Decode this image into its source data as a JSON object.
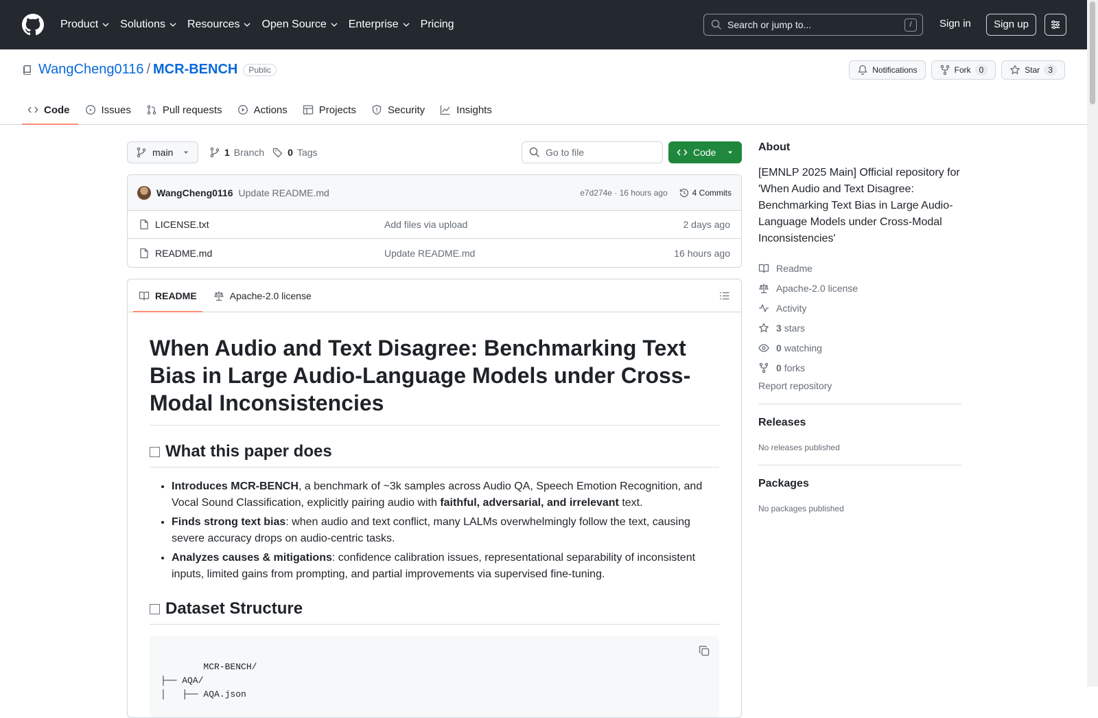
{
  "header": {
    "nav": [
      "Product",
      "Solutions",
      "Resources",
      "Open Source",
      "Enterprise",
      "Pricing"
    ],
    "search_placeholder": "Search or jump to...",
    "search_shortcut": "/",
    "sign_in": "Sign in",
    "sign_up": "Sign up"
  },
  "repo": {
    "owner": "WangCheng0116",
    "separator": "/",
    "name": "MCR-BENCH",
    "visibility": "Public",
    "notifications_label": "Notifications",
    "fork_label": "Fork",
    "fork_count": "0",
    "star_label": "Star",
    "star_count": "3"
  },
  "tabs": [
    "Code",
    "Issues",
    "Pull requests",
    "Actions",
    "Projects",
    "Security",
    "Insights"
  ],
  "toolbar": {
    "branch": "main",
    "branch_count": "1",
    "branch_label": "Branch",
    "tag_count": "0",
    "tag_label": "Tags",
    "go_to_file": "Go to file",
    "code_button": "Code"
  },
  "commit": {
    "author": "WangCheng0116",
    "message": "Update README.md",
    "hash_time": "e7d274e · 16 hours ago",
    "commits": "4 Commits"
  },
  "files": [
    {
      "name": "LICENSE.txt",
      "message": "Add files via upload",
      "date": "2 days ago"
    },
    {
      "name": "README.md",
      "message": "Update README.md",
      "date": "16 hours ago"
    }
  ],
  "readme": {
    "tab_readme": "README",
    "tab_license": "Apache-2.0 license",
    "title": "When Audio and Text Disagree: Benchmarking Text Bias in Large Audio-Language Models under Cross-Modal Inconsistencies",
    "section1": "What this paper does",
    "bullets": [
      {
        "bold": "Introduces MCR-BENCH",
        "text1": ", a benchmark of ~3k samples across Audio QA, Speech Emotion Recognition, and Vocal Sound Classification, explicitly pairing audio with ",
        "bold2": "faithful, adversarial, and irrelevant",
        "text2": " text."
      },
      {
        "bold": "Finds strong text bias",
        "text1": ": when audio and text conflict, many LALMs overwhelmingly follow the text, causing severe accuracy drops on audio-centric tasks.",
        "bold2": "",
        "text2": ""
      },
      {
        "bold": "Analyzes causes & mitigations",
        "text1": ": confidence calibration issues, representational separability of inconsistent inputs, limited gains from prompting, and partial improvements via supervised fine-tuning.",
        "bold2": "",
        "text2": ""
      }
    ],
    "section2": "Dataset Structure",
    "code": "MCR-BENCH/\n├── AQA/\n│   ├── AQA.json"
  },
  "about": {
    "heading": "About",
    "description": "[EMNLP 2025 Main] Official repository for 'When Audio and Text Disagree: Benchmarking Text Bias in Large Audio-Language Models under Cross-Modal Inconsistencies'",
    "readme": "Readme",
    "license": "Apache-2.0 license",
    "activity": "Activity",
    "stars_count": "3",
    "stars_label": "stars",
    "watching_count": "0",
    "watching_label": "watching",
    "forks_count": "0",
    "forks_label": "forks",
    "report": "Report repository"
  },
  "releases": {
    "heading": "Releases",
    "empty": "No releases published"
  },
  "packages": {
    "heading": "Packages",
    "empty": "No packages published"
  }
}
